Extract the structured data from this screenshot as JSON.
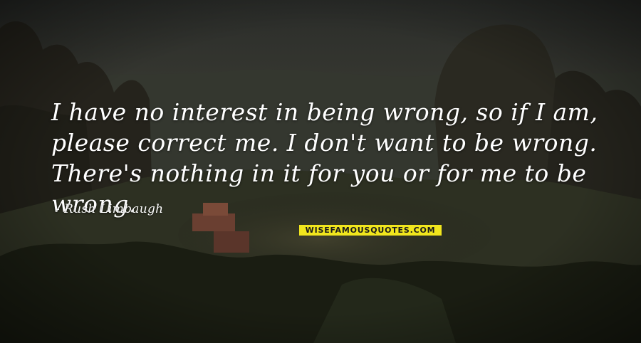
{
  "quote": {
    "text": "I have no interest in being wrong, so if I am, please correct me. I don't want to be wrong. There's nothing in it for you or for me to be wrong.",
    "author": "Rush Limbaugh",
    "author_prefix": "-"
  },
  "watermark": {
    "text": "WISEFAMOUSQUOTES.COM"
  },
  "colors": {
    "text": "#ffffff",
    "watermark_bg": "#f1e61d",
    "watermark_text": "#1a1a1a"
  },
  "background": {
    "description_icon": "mountain-landscape-photo"
  }
}
